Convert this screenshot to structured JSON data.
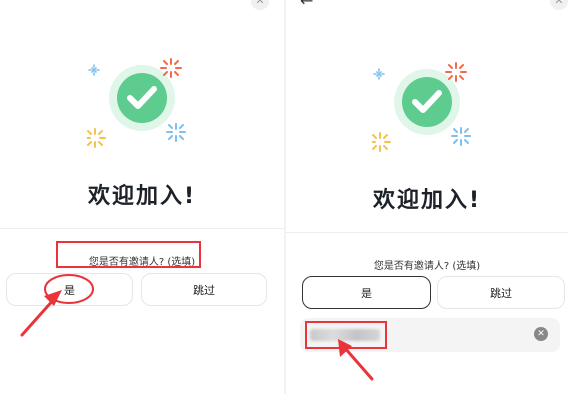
{
  "onboarding": {
    "welcome_title": "欢迎加入!",
    "referrer_question": "您是否有邀请人? (选填)",
    "yes_label": "是",
    "skip_label": "跳过"
  },
  "icons": {
    "close": "close-icon",
    "back": "back-arrow-icon",
    "success": "check-circle-icon",
    "sparkle": "sparkle-icon",
    "clear": "clear-input-icon"
  },
  "colors": {
    "success_green": "#5ecc8e",
    "success_halo": "#dff6e9",
    "annotation_red": "#e8343a",
    "sparkle_blue": "#7cc0ee",
    "sparkle_orange": "#f26a4a",
    "sparkle_yellow": "#f5c34b"
  }
}
